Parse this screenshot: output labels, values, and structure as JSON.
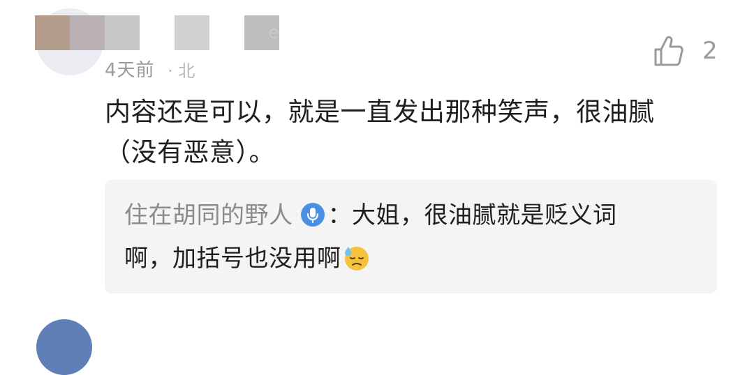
{
  "comment": {
    "username_visible_suffix": "e",
    "timestamp": "4天前",
    "timestamp_suffix": "· 北",
    "text": "内容还是可以，就是一直发出那种笑声，很油腻（没有恶意）。",
    "like_count": "2"
  },
  "reply": {
    "author": "住在胡同的野人",
    "separator": "：",
    "line1_text": "大姐，很油腻就是贬义词",
    "line2_text": "啊，加括号也没用啊",
    "author_badge_icon": "microphone-badge-icon",
    "emoji_icon": "downcast-sweat-emoji-icon"
  },
  "colors": {
    "reply_background": "#f4f4f5",
    "badge_blue": "#4a90e2",
    "secondary_text": "#9a9a9a",
    "primary_text": "#1f1f1f"
  }
}
